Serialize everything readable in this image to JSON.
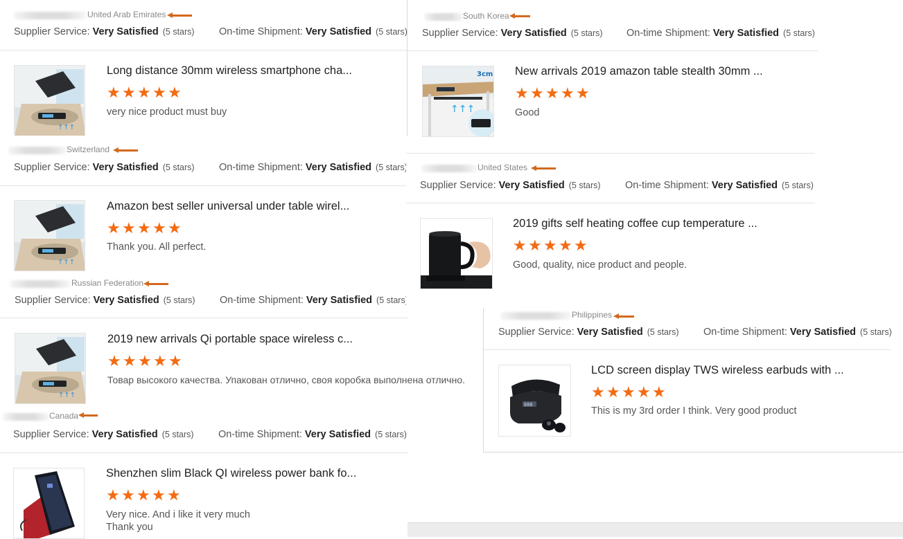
{
  "labels": {
    "supplier_service": "Supplier Service:",
    "ontime_shipment": "On-time Shipment:",
    "very_satisfied": "Very Satisfied",
    "five_stars": "(5 stars)"
  },
  "star_glyph": "★",
  "accent_colors": {
    "star": "#f36b12",
    "arrow": "#d2691e"
  },
  "reviews": [
    {
      "country": "United Arab Emirates",
      "product_title": "Long distance 30mm wireless smartphone cha...",
      "rating": 5,
      "review_text": "very nice product must buy",
      "image": "wireless-charger-table-icon"
    },
    {
      "country": "Switzerland",
      "product_title": "Amazon best seller universal under table wirel...",
      "rating": 5,
      "review_text": "Thank you. All perfect.",
      "image": "wireless-charger-table-icon"
    },
    {
      "country": "Russian Federation",
      "product_title": "2019 new arrivals Qi portable space wireless c...",
      "rating": 5,
      "review_text": "Товар высокого качества. Упакован отлично, своя коробка выполнена отлично.",
      "image": "wireless-charger-table-icon"
    },
    {
      "country": "Canada",
      "product_title": "Shenzhen slim Black QI wireless power bank fo...",
      "rating": 5,
      "review_text": "Very nice. And i like it very much",
      "review_text_2": "Thank you",
      "image": "power-bank-icon"
    },
    {
      "country": "South Korea",
      "product_title": "New arrivals 2019 amazon table stealth 30mm ...",
      "rating": 5,
      "review_text": "Good",
      "image": "stealth-charger-desk-icon",
      "image_badge": "3cm"
    },
    {
      "country": "United States",
      "product_title": "2019 gifts self heating coffee cup temperature ...",
      "rating": 5,
      "review_text": "Good, quality, nice product and people.",
      "image": "coffee-mug-icon"
    },
    {
      "country": "Philippines",
      "product_title": "LCD screen display TWS wireless earbuds with ...",
      "rating": 5,
      "review_text": "This is my 3rd order I think. Very good product",
      "image": "earbuds-case-icon"
    }
  ]
}
